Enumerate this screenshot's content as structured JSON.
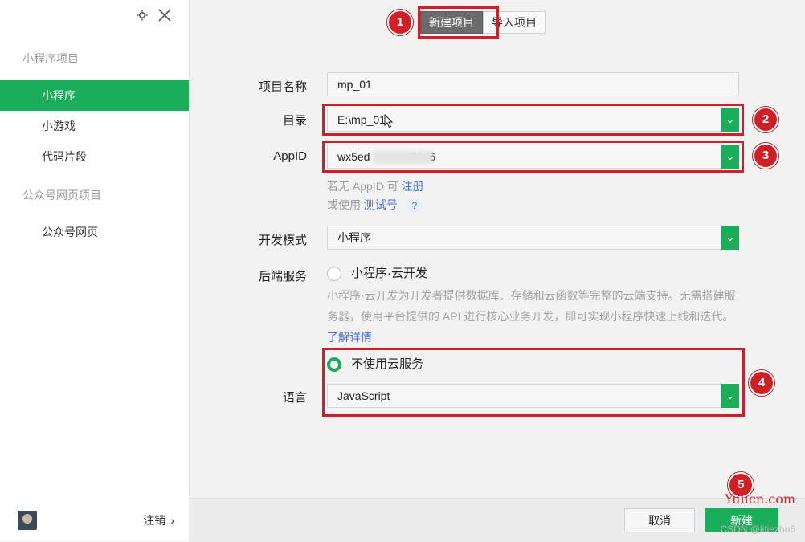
{
  "sidebar": {
    "group1": "小程序项目",
    "items1": [
      "小程序",
      "小游戏",
      "代码片段"
    ],
    "group2": "公众号网页项目",
    "items2": [
      "公众号网页"
    ],
    "logout": "注销"
  },
  "tabs": [
    "新建项目",
    "导入项目"
  ],
  "form": {
    "project_name_label": "项目名称",
    "project_name_value": "mp_01",
    "dir_label": "目录",
    "dir_value": "E:\\mp_01",
    "appid_label": "AppID",
    "appid_value": "wx5ed             29d6",
    "hint_no_appid": "若无 AppID 可",
    "hint_register": "注册",
    "hint_or_use": "或使用",
    "hint_test": "测试号",
    "help_q": "?",
    "devmode_label": "开发模式",
    "devmode_value": "小程序",
    "backend_label": "后端服务",
    "cloud_option": "小程序·云开发",
    "cloud_desc": "小程序·云开发为开发者提供数据库、存储和云函数等完整的云端支持。无需搭建服务器，使用平台提供的 API 进行核心业务开发，即可实现小程序快速上线和迭代。",
    "learn_more": "了解详情",
    "no_cloud_option": "不使用云服务",
    "lang_label": "语言",
    "lang_value": "JavaScript"
  },
  "markers": [
    "1",
    "2",
    "3",
    "4",
    "5"
  ],
  "footer": {
    "cancel": "取消",
    "create": "新建",
    "watermark": "CSDN @litiezhu6",
    "site": "Yuucn.com"
  },
  "colors": {
    "accent": "#1aad5a",
    "annotation": "#cf1f2b"
  }
}
